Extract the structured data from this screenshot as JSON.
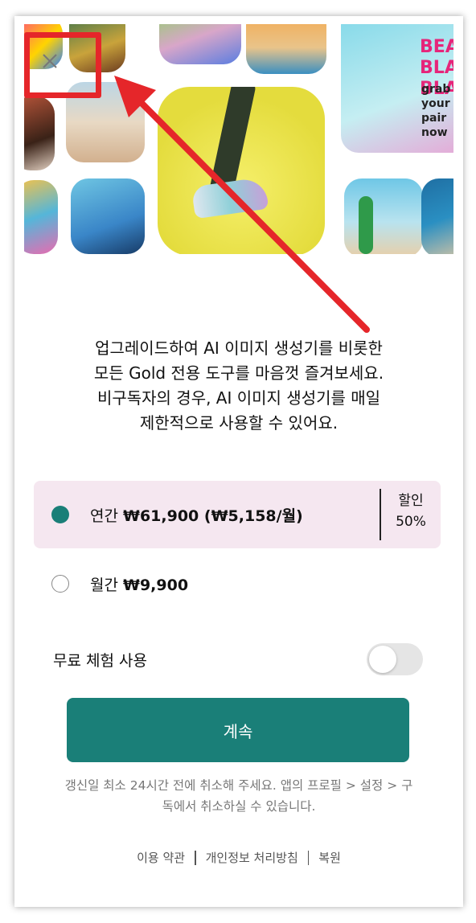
{
  "description_lines": [
    "업그레이드하여 AI 이미지 생성기를 비롯한",
    "모든 Gold 전용 도구를 마음껏 즐겨보세요.",
    "비구독자의 경우, AI 이미지 생성기를 매일",
    "제한적으로 사용할 수 있어요."
  ],
  "hero": {
    "promo_text": "BEAM BLAH BLAH",
    "promo_sub": "grab your pair now"
  },
  "plans": {
    "annual": {
      "label_prefix": "연간 ",
      "price": "₩61,900 (₩5,158/월)",
      "discount_line1": "할인",
      "discount_line2": "50%",
      "selected": true
    },
    "monthly": {
      "label_prefix": "월간 ",
      "price": "₩9,900",
      "selected": false
    }
  },
  "trial": {
    "label": "무료 체험 사용",
    "enabled": false
  },
  "cta_label": "계속",
  "note_lines": [
    "갱신일 최소 24시간 전에 취소해 주세요. 앱의 프로필 > 설정 > 구",
    "독에서 취소하실 수 있습니다."
  ],
  "footer": {
    "terms": "이용 약관",
    "privacy": "개인정보 처리방침",
    "restore": "복원"
  },
  "colors": {
    "accent": "#1a7f78",
    "selected_plan_bg": "#f5e7f0",
    "annotation_red": "#e5262a"
  },
  "icons": {
    "close": "close-icon",
    "annotation": "arrow-annotation"
  }
}
